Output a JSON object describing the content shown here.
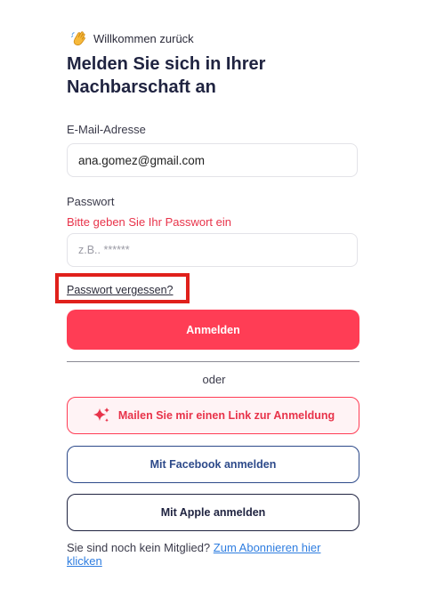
{
  "header": {
    "welcome": "Willkommen zurück",
    "title": "Melden Sie sich in Ihrer Nachbarschaft an"
  },
  "form": {
    "email_label": "E-Mail-Adresse",
    "email_value": "ana.gomez@gmail.com",
    "password_label": "Passwort",
    "password_error": "Bitte geben Sie Ihr Passwort ein",
    "password_placeholder": "z.B.. ******",
    "forgot_link": "Passwort vergessen?",
    "submit_label": "Anmelden"
  },
  "alt_login": {
    "divider_text": "oder",
    "magic_link_label": "Mailen Sie mir einen Link zur Anmeldung",
    "facebook_label": "Mit Facebook anmelden",
    "apple_label": "Mit Apple anmelden"
  },
  "footer": {
    "text": "Sie sind noch kein Mitglied?",
    "link": "Zum Abonnieren hier klicken"
  },
  "colors": {
    "primary": "#ff3d55",
    "facebook": "#2d4a8a",
    "dark": "#1f2340",
    "link": "#2e7de0",
    "highlight": "#e0201b"
  }
}
